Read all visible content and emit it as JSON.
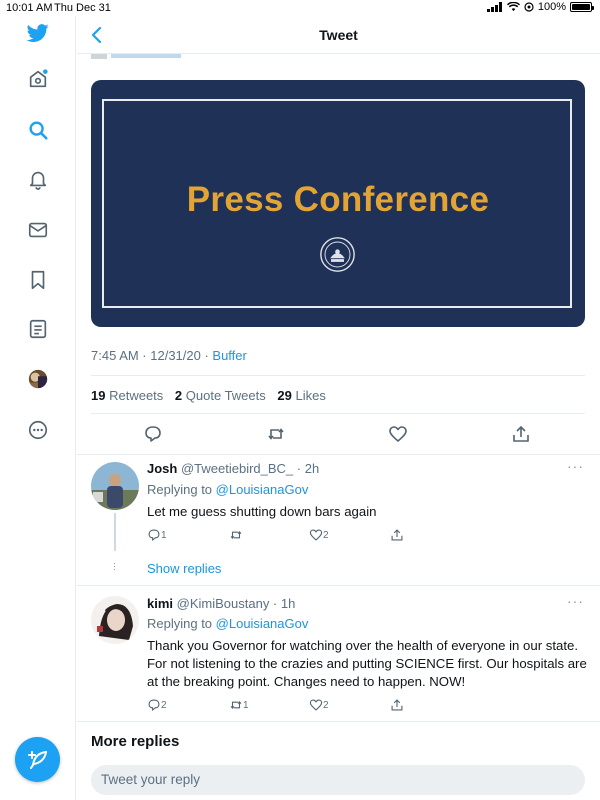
{
  "status_bar": {
    "time": "10:01 AM",
    "date": "Thu Dec 31",
    "battery": "100%"
  },
  "header": {
    "title": "Tweet"
  },
  "sidebar": {
    "items": [
      "twitter-logo",
      "home-icon",
      "explore-icon",
      "notifications-icon",
      "messages-icon",
      "bookmarks-icon",
      "lists-icon",
      "profile-avatar",
      "more-icon"
    ]
  },
  "tweet": {
    "media_text": "Press Conference",
    "time": "7:45 AM · 12/31/20 · ",
    "source": "Buffer",
    "retweets_count": "19",
    "retweets_label": "Retweets",
    "quotes_count": "2",
    "quotes_label": "Quote Tweets",
    "likes_count": "29",
    "likes_label": "Likes"
  },
  "replies": [
    {
      "name": "Josh",
      "handle": "@Tweetiebird_BC_ · 2h",
      "replying_prefix": "Replying to ",
      "replying_to": "@LouisianaGov",
      "text": "Let me guess shutting down bars again",
      "reply_count": "1",
      "retweet_count": "",
      "like_count": "2",
      "show_replies": "Show replies"
    },
    {
      "name": "kimi",
      "handle": "@KimiBoustany · 1h",
      "replying_prefix": "Replying to ",
      "replying_to": "@LouisianaGov",
      "text": "Thank you Governor for watching over the health of everyone in our state. For not listening to the crazies and putting SCIENCE first. Our hospitals are at the breaking point. Changes need to happen. NOW!",
      "reply_count": "2",
      "retweet_count": "1",
      "like_count": "2"
    }
  ],
  "more_replies": "More replies",
  "reply_placeholder": "Tweet your reply",
  "colors": {
    "accent": "#1da1f2",
    "media_bg": "#1f3157",
    "media_text": "#e2a434"
  }
}
